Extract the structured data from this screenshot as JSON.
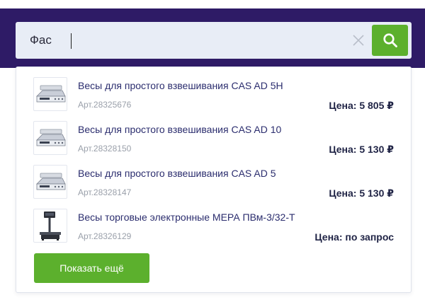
{
  "search": {
    "value": "Фас",
    "clear_icon": "close-icon",
    "submit_icon": "search-icon"
  },
  "results": [
    {
      "title": "Весы для простого взвешивания CAS AD 5H",
      "article": "Арт.28325676",
      "price": "Цена: 5 805 ₽",
      "image_icon": "bench-scale-icon"
    },
    {
      "title": "Весы для простого взвешивания CAS AD 10",
      "article": "Арт.28328150",
      "price": "Цена: 5 130 ₽",
      "image_icon": "bench-scale-icon"
    },
    {
      "title": "Весы для простого взвешивания CAS AD 5",
      "article": "Арт.28328147",
      "price": "Цена: 5 130 ₽",
      "image_icon": "bench-scale-icon"
    },
    {
      "title": "Весы торговые электронные МЕРА ПВм-3/32-Т",
      "article": "Арт.28326129",
      "price": "Цена: по запрос",
      "image_icon": "pole-scale-icon"
    }
  ],
  "show_more_label": "Показать ещё",
  "colors": {
    "header_bg": "#2e1b66",
    "search_bg": "#e8edf6",
    "accent_green": "#5cb02d",
    "title_text": "#2b2d6e",
    "muted_text": "#9aa0aa"
  }
}
